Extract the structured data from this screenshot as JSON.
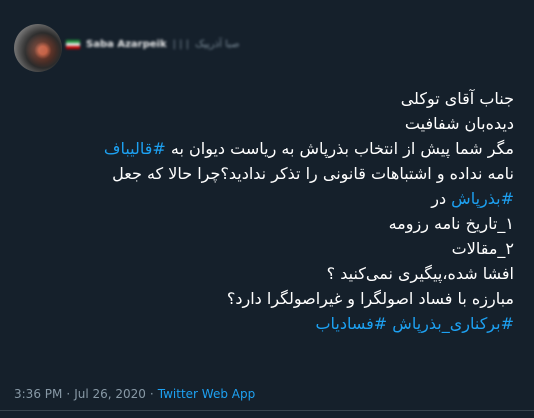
{
  "user": {
    "display_name": "Saba Azarpeik",
    "handle_suffix": "صبا آذرپیک",
    "flag_icon": "iran-flag-icon"
  },
  "tweet": {
    "lines": [
      [
        {
          "text": "جناب آقای توکلی",
          "tag": false
        }
      ],
      [
        {
          "text": "دیده‌بان شفافیت",
          "tag": false
        }
      ],
      [
        {
          "text": "مگر شما پیش از انتخاب بذرپاش به ریاست دیوان به ",
          "tag": false
        },
        {
          "text": "#قالیباف",
          "tag": true
        }
      ],
      [
        {
          "text": "نامه نداده و اشتباهات قانونی را تذکر ندادید؟چرا حالا که جعل",
          "tag": false
        }
      ],
      [
        {
          "text": "#بذرپاش",
          "tag": true
        },
        {
          "text": " در",
          "tag": false
        }
      ],
      [
        {
          "text": "۱_تاریخ نامه رزومه",
          "tag": false
        }
      ],
      [
        {
          "text": "۲_مقالات",
          "tag": false
        }
      ],
      [
        {
          "text": "افشا شده،پیگیری نمی‌کنید ؟",
          "tag": false
        }
      ],
      [
        {
          "text": "مبارزه با فساد اصولگرا و غیراصولگرا دارد؟",
          "tag": false
        }
      ],
      [
        {
          "text": "#برکناری_بذرپاش",
          "tag": true
        },
        {
          "text": " ",
          "tag": false
        },
        {
          "text": "#فسادیاب",
          "tag": true
        }
      ]
    ]
  },
  "meta": {
    "time": "3:36 PM",
    "separator": "·",
    "date": "Jul 26, 2020",
    "source": "Twitter Web App"
  },
  "colors": {
    "background": "#15202b",
    "text": "#ffffff",
    "link": "#1da1f2",
    "secondary": "#8899a6"
  }
}
